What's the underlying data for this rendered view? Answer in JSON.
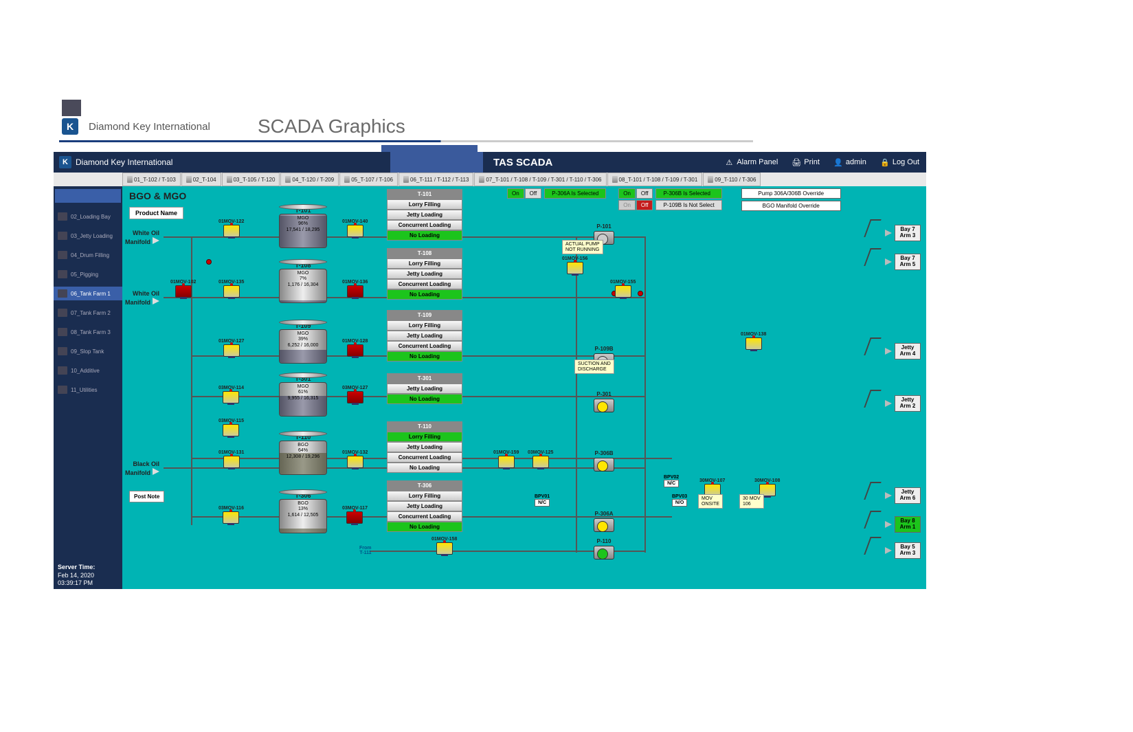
{
  "docHeader": {
    "company": "Diamond Key International",
    "title": "SCADA Graphics"
  },
  "appHeader": {
    "company": "Diamond Key International",
    "appTitle": "TAS SCADA",
    "tools": {
      "alarm": "Alarm Panel",
      "print": "Print",
      "admin": "admin",
      "logout": "Log Out"
    }
  },
  "viewTabs": [
    "01_T-102 / T-103",
    "02_T-104",
    "03_T-105 / T-120",
    "04_T-120 / T-209",
    "05_T-107 / T-106",
    "06_T-111 / T-112 / T-113",
    "07_T-101 / T-108 / T-109 / T-301 / T-110 / T-306",
    "08_T-101 / T-108 / T-109 / T-301",
    "09_T-110 / T-306"
  ],
  "sidebar": [
    {
      "label": "02_Loading Bay",
      "active": false
    },
    {
      "label": "03_Jetty Loading",
      "active": false
    },
    {
      "label": "04_Drum Filling",
      "active": false
    },
    {
      "label": "05_Pigging",
      "active": false
    },
    {
      "label": "06_Tank Farm 1",
      "active": true
    },
    {
      "label": "07_Tank Farm 2",
      "active": false
    },
    {
      "label": "08_Tank Farm 3",
      "active": false
    },
    {
      "label": "09_Slop Tank",
      "active": false
    },
    {
      "label": "10_Additive",
      "active": false
    },
    {
      "label": "11_Utilities",
      "active": false
    }
  ],
  "serverTime": {
    "label": "Server Time:",
    "date": "Feb 14, 2020",
    "time": "03:39:17 PM"
  },
  "canvas": {
    "title": "BGO & MGO",
    "productBtn": "Product Name",
    "postNote": "Post Note",
    "status": {
      "p306a": {
        "on": "On",
        "off": "Off",
        "text": "P-306A Is Selected"
      },
      "p306b": {
        "on": "On",
        "off": "Off",
        "text": "P-306B Is Selected"
      },
      "p109b": {
        "on": "On",
        "off": "Off",
        "text": "P-109B Is Not Select"
      },
      "override1": "Pump 306A/306B Override",
      "override2": "BGO Manifold Override"
    },
    "manifolds": {
      "white1": "White Oil\nManifold",
      "white2": "White Oil\nManifold",
      "black": "Black Oil\nManifold"
    },
    "valves": {
      "v101": "01MOV-122",
      "v102": "01MOV-140",
      "v103": "01MOV-102",
      "v104": "01MOV-135",
      "v105": "01MOV-136",
      "v106": "01MOV-127",
      "v107": "01MOV-128",
      "v108": "03MOV-114",
      "v109": "03MOV-127",
      "v110": "03MOV-115",
      "v111": "01MOV-131",
      "v112": "01MOV-132",
      "v113": "03MOV-116",
      "v114": "03MOV-117",
      "v115": "01MOV-156",
      "v116": "01MOV-155",
      "v117": "01MOV-159",
      "v118": "03MOV-125",
      "v119": "01MOV-158",
      "v120": "01MOV-138",
      "v121": "30MOV-107",
      "v122": "30MOV-108"
    },
    "tanks": {
      "t101": {
        "name": "T-101",
        "product": "MGO",
        "pct": "96%",
        "vol": "17,541 / 18,295",
        "fill": 96
      },
      "t108": {
        "name": "T-108",
        "product": "MGO",
        "pct": "7%",
        "vol": "1,176 / 16,304",
        "fill": 7
      },
      "t109": {
        "name": "T-109",
        "product": "MGO",
        "pct": "39%",
        "vol": "6,252 / 16,000",
        "fill": 39
      },
      "t301": {
        "name": "T-301",
        "product": "MGO",
        "pct": "61%",
        "vol": "9,955 / 16,315",
        "fill": 61
      },
      "t110": {
        "name": "T-110",
        "product": "BGO",
        "pct": "64%",
        "vol": "12,308 / 19,296",
        "fill": 64
      },
      "t306": {
        "name": "T-306",
        "product": "BGO",
        "pct": "13%",
        "vol": "1,614 / 12,505",
        "fill": 13
      }
    },
    "panels": {
      "t101": {
        "hdr": "T-101",
        "r1": "Lorry Filling",
        "r2": "Jetty Loading",
        "r3": "Concurrent Loading",
        "r4": "No Loading",
        "active": 4
      },
      "t108": {
        "hdr": "T-108",
        "r1": "Lorry Filling",
        "r2": "Jetty Loading",
        "r3": "Concurrent Loading",
        "r4": "No Loading",
        "active": 4
      },
      "t109": {
        "hdr": "T-109",
        "r1": "Lorry Filling",
        "r2": "Jetty Loading",
        "r3": "Concurrent Loading",
        "r4": "No Loading",
        "active": 4
      },
      "t301": {
        "hdr": "T-301",
        "r1": "Jetty Loading",
        "r2": "No Loading",
        "active": 2
      },
      "t110": {
        "hdr": "T-110",
        "r1": "Lorry Filling",
        "r2": "Jetty Loading",
        "r3": "Concurrent Loading",
        "r4": "No Loading",
        "active": 1
      },
      "t306": {
        "hdr": "T-306",
        "r1": "Lorry Filling",
        "r2": "Jetty Loading",
        "r3": "Concurrent Loading",
        "r4": "No Loading",
        "active": 4
      }
    },
    "pumps": {
      "p101": {
        "label": "P-101",
        "color": "gray"
      },
      "p109b": {
        "label": "P-109B",
        "color": "gray"
      },
      "p301": {
        "label": "P-301",
        "color": "yellow"
      },
      "p306b": {
        "label": "P-306B",
        "color": "yellow"
      },
      "p306a": {
        "label": "P-306A",
        "color": "yellow"
      },
      "p110": {
        "label": "P-110",
        "color": "green"
      }
    },
    "notes": {
      "p101note": "ACTUAL PUMP\nNOT RUNNING",
      "p109bnote": "SUCTION AND\nDISCHARGE",
      "movnote1": "MOV\nONSITE",
      "movnote2": "30 MOV\n106"
    },
    "bpv": {
      "bpv01": "BPV01",
      "bpv01s": "N/C",
      "bpv02": "BPV02",
      "bpv02s": "N/C",
      "bpv03": "BPV03",
      "bpv03s": "N/O"
    },
    "bays": {
      "b1": "Bay 7\nArm 3",
      "b2": "Bay 7\nArm 5",
      "b3": "Jetty\nArm 4",
      "b4": "Jetty\nArm 2",
      "b5": "Jetty\nArm 6",
      "b6": "Bay 8\nArm 1",
      "b7": "Bay 5\nArm 3"
    },
    "fromLabel": "From\nT-111"
  }
}
